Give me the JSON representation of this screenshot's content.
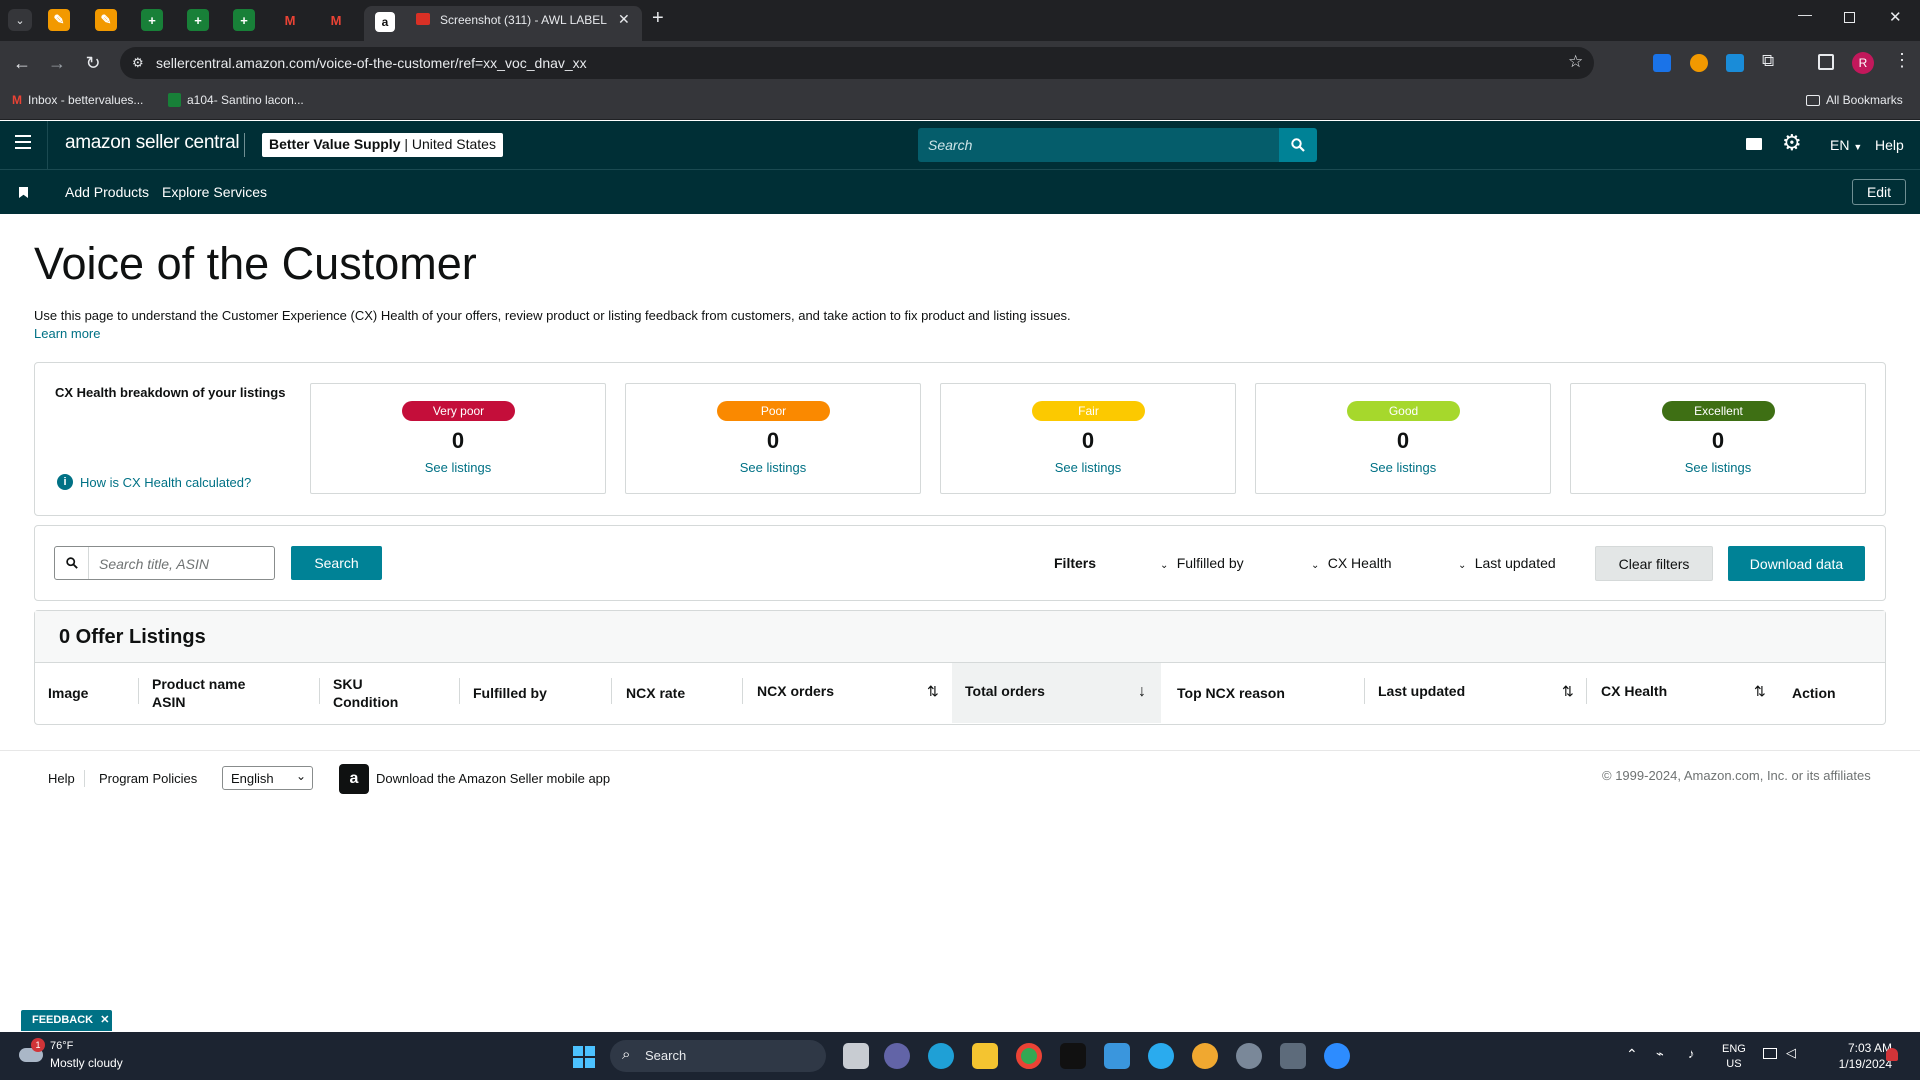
{
  "browser": {
    "active_tab_title": "Screenshot (311) - AWL LABEL",
    "url": "sellercentral.amazon.com/voice-of-the-customer/ref=xx_voc_dnav_xx",
    "bookmarks": [
      "Inbox - bettervalues...",
      "a104- Santino lacon..."
    ],
    "all_bookmarks": "All Bookmarks",
    "profile_initial": "R"
  },
  "header": {
    "logo": "amazon seller central",
    "store_name": "Better Value Supply",
    "marketplace": "United States",
    "search_placeholder": "Search",
    "language": "EN",
    "help": "Help"
  },
  "subnav": {
    "items": [
      "Add Products",
      "Explore Services"
    ],
    "edit": "Edit"
  },
  "page": {
    "title": "Voice of the Customer",
    "description": "Use this page to understand the Customer Experience (CX) Health of your offers, review product or listing feedback from customers, and take action to fix product and listing issues.",
    "learn_more": "Learn more"
  },
  "cx_health": {
    "heading": "CX Health breakdown of your listings",
    "how_link": "How is CX Health calculated?",
    "cards": [
      {
        "label": "Very poor",
        "count": "0",
        "link": "See listings",
        "color": "#c40e3a",
        "text_color": "#ffffff"
      },
      {
        "label": "Poor",
        "count": "0",
        "link": "See listings",
        "color": "#fa8900",
        "text_color": "#ffffff"
      },
      {
        "label": "Fair",
        "count": "0",
        "link": "See listings",
        "color": "#fcc900",
        "text_color": "#ffffff"
      },
      {
        "label": "Good",
        "count": "0",
        "link": "See listings",
        "color": "#a6d82c",
        "text_color": "#ffffff"
      },
      {
        "label": "Excellent",
        "count": "0",
        "link": "See listings",
        "color": "#3e6f14",
        "text_color": "#ffffff"
      }
    ]
  },
  "filters": {
    "search_placeholder": "Search title, ASIN",
    "search_button": "Search",
    "label": "Filters",
    "fulfilled_by": "Fulfilled by",
    "cx_health": "CX Health",
    "last_updated": "Last updated",
    "clear": "Clear filters",
    "download": "Download data"
  },
  "listings": {
    "title": "0 Offer Listings",
    "columns": {
      "image": "Image",
      "product_name": "Product name",
      "asin": "ASIN",
      "sku": "SKU",
      "condition": "Condition",
      "fulfilled_by": "Fulfilled by",
      "ncx_rate": "NCX rate",
      "ncx_orders": "NCX orders",
      "total_orders": "Total orders",
      "top_ncx_reason": "Top NCX reason",
      "last_updated": "Last updated",
      "cx_health": "CX Health",
      "action": "Action"
    }
  },
  "footer": {
    "help": "Help",
    "program_policies": "Program Policies",
    "language": "English",
    "app_download": "Download the Amazon Seller mobile app",
    "copyright": "© 1999-2024, Amazon.com, Inc. or its affiliates"
  },
  "feedback": "FEEDBACK",
  "taskbar": {
    "weather_temp": "76°F",
    "weather_desc": "Mostly cloudy",
    "weather_badge": "1",
    "search": "Search",
    "lang": "ENG",
    "region": "US",
    "time": "7:03 AM",
    "date": "1/19/2024"
  }
}
